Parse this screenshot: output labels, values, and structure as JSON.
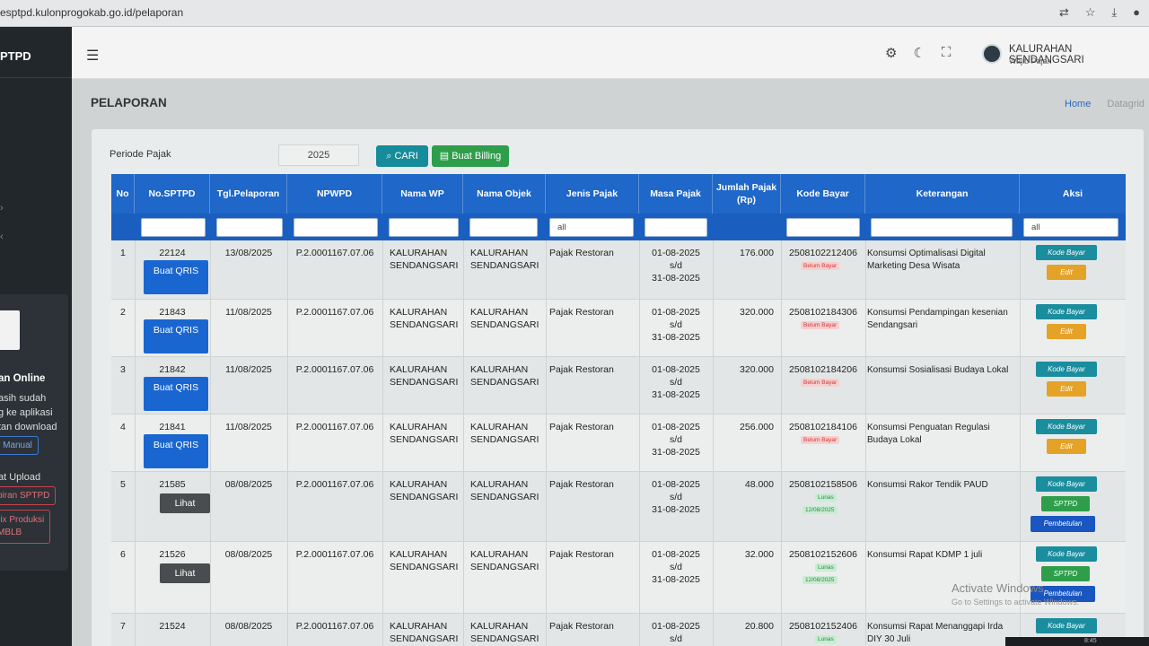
{
  "browser": {
    "url": "esptpd.kulonprogokab.go.id/pelaporan",
    "icons": [
      "translate-icon",
      "star-icon",
      "download-icon",
      "profile-icon"
    ]
  },
  "sidebar": {
    "brand": "PTPD",
    "card_title": "an Online",
    "card_lines": [
      "asih sudah",
      "g ke aplikasi",
      "tan download"
    ],
    "manual_label": "r Manual",
    "upload_title": "at Upload",
    "upload_btn1": "piran SPTPD",
    "upload_btn2_line1": "rix Produksi",
    "upload_btn2_line2": "MBLB"
  },
  "topbar": {
    "user_name": "KALURAHAN SENDANGSARI",
    "user_role": "Wajib Pajak"
  },
  "page": {
    "title": "PELAPORAN",
    "breadcrumb_home": "Home",
    "breadcrumb_current": "Datagrid"
  },
  "filter": {
    "periode_label": "Periode Pajak",
    "periode_value": "2025",
    "cari_label": "CARI",
    "billing_label": "Buat Billing"
  },
  "table": {
    "headers": [
      "No",
      "No.SPTPD",
      "Tgl.Pelaporan",
      "NPWPD",
      "Nama WP",
      "Nama Objek",
      "Jenis Pajak",
      "Masa Pajak",
      "Jumlah Pajak (Rp)",
      "Kode Bayar",
      "Keterangan",
      "Aksi"
    ],
    "filter_jenis": "all",
    "filter_aksi": "all",
    "rows": [
      {
        "no": "1",
        "sptpd": "22124",
        "tgl": "13/08/2025",
        "npwpd": "P.2.0001167.07.06",
        "wp1": "KALURAHAN",
        "wp2": "SENDANGSARI",
        "obj1": "KALURAHAN",
        "obj2": "SENDANGSARI",
        "jenis": "Pajak Restoran",
        "masa1": "01-08-2025",
        "masa2": "s/d",
        "masa3": "31-08-2025",
        "jumlah": "176.000",
        "kode": "2508102212406",
        "status": "Belum Bayar",
        "ket": "Konsumsi Optimalisasi Digital Marketing Desa Wisata",
        "btn": "Buat QRIS"
      },
      {
        "no": "2",
        "sptpd": "21843",
        "tgl": "11/08/2025",
        "npwpd": "P.2.0001167.07.06",
        "wp1": "KALURAHAN",
        "wp2": "SENDANGSARI",
        "obj1": "KALURAHAN",
        "obj2": "SENDANGSARI",
        "jenis": "Pajak Restoran",
        "masa1": "01-08-2025",
        "masa2": "s/d",
        "masa3": "31-08-2025",
        "jumlah": "320.000",
        "kode": "2508102184306",
        "status": "Belum Bayar",
        "ket": "Konsumsi Pendampingan kesenian Sendangsari",
        "btn": "Buat QRIS"
      },
      {
        "no": "3",
        "sptpd": "21842",
        "tgl": "11/08/2025",
        "npwpd": "P.2.0001167.07.06",
        "wp1": "KALURAHAN",
        "wp2": "SENDANGSARI",
        "obj1": "KALURAHAN",
        "obj2": "SENDANGSARI",
        "jenis": "Pajak Restoran",
        "masa1": "01-08-2025",
        "masa2": "s/d",
        "masa3": "31-08-2025",
        "jumlah": "320.000",
        "kode": "2508102184206",
        "status": "Belum Bayar",
        "ket": "Konsumsi Sosialisasi Budaya Lokal",
        "btn": "Buat QRIS"
      },
      {
        "no": "4",
        "sptpd": "21841",
        "tgl": "11/08/2025",
        "npwpd": "P.2.0001167.07.06",
        "wp1": "KALURAHAN",
        "wp2": "SENDANGSARI",
        "obj1": "KALURAHAN",
        "obj2": "SENDANGSARI",
        "jenis": "Pajak Restoran",
        "masa1": "01-08-2025",
        "masa2": "s/d",
        "masa3": "31-08-2025",
        "jumlah": "256.000",
        "kode": "2508102184106",
        "status": "Belum Bayar",
        "ket": "Konsumsi Penguatan Regulasi Budaya Lokal",
        "btn": "Buat QRIS"
      },
      {
        "no": "5",
        "sptpd": "21585",
        "tgl": "08/08/2025",
        "npwpd": "P.2.0001167.07.06",
        "wp1": "KALURAHAN",
        "wp2": "SENDANGSARI",
        "obj1": "KALURAHAN",
        "obj2": "SENDANGSARI",
        "jenis": "Pajak Restoran",
        "masa1": "01-08-2025",
        "masa2": "s/d",
        "masa3": "31-08-2025",
        "jumlah": "48.000",
        "kode": "2508102158506",
        "status": "Lunas",
        "paid": "12/08/2025",
        "ket": "Konsumsi Rakor Tendik PAUD",
        "btn": "Lihat"
      },
      {
        "no": "6",
        "sptpd": "21526",
        "tgl": "08/08/2025",
        "npwpd": "P.2.0001167.07.06",
        "wp1": "KALURAHAN",
        "wp2": "SENDANGSARI",
        "obj1": "KALURAHAN",
        "obj2": "SENDANGSARI",
        "jenis": "Pajak Restoran",
        "masa1": "01-08-2025",
        "masa2": "s/d",
        "masa3": "31-08-2025",
        "jumlah": "32.000",
        "kode": "2508102152606",
        "status": "Lunas",
        "paid": "12/08/2025",
        "ket": "Konsumsi Rapat KDMP 1 juli",
        "btn": "Lihat"
      },
      {
        "no": "7",
        "sptpd": "21524",
        "tgl": "08/08/2025",
        "npwpd": "P.2.0001167.07.06",
        "wp1": "KALURAHAN",
        "wp2": "SENDANGSARI",
        "obj1": "KALURAHAN",
        "obj2": "SENDANGSARI",
        "jenis": "Pajak Restoran",
        "masa1": "01-08-2025",
        "masa2": "s/d",
        "masa3": "",
        "jumlah": "20.800",
        "kode": "2508102152406",
        "status": "Lunas",
        "ket": "Konsumsi Rapat Menanggapi Irda DIY 30 Juli",
        "btn": ""
      }
    ],
    "action_kode": "Kode Bayar",
    "action_edit": "Edit",
    "action_sptpd": "SPTPD",
    "action_pemb": "Pembetulan"
  },
  "watermark": {
    "line1": "Activate Windows",
    "line2": "Go to Settings to activate Windows."
  },
  "clock": "8:45",
  "colors": {
    "header_blue": "#1f67c8",
    "qris_blue": "#1a66d0",
    "kode_teal": "#1a8d9e",
    "edit_orange": "#e4a227",
    "sptpd_green": "#2e9e4a",
    "sidebar_dark": "#22272b"
  }
}
